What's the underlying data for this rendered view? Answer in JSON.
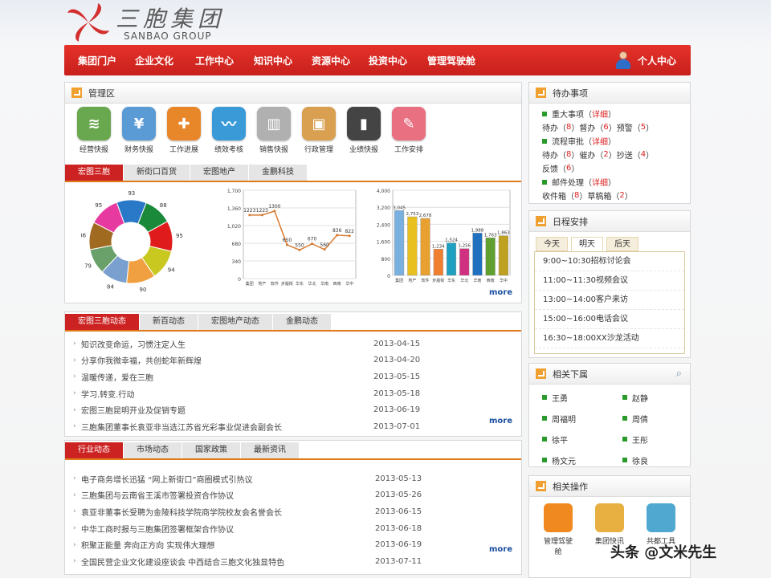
{
  "brand": {
    "cn": "三胞集团",
    "en": "SANBAO GROUP"
  },
  "nav": {
    "items": [
      "集团门户",
      "企业文化",
      "工作中心",
      "知识中心",
      "资源中心",
      "投资中心",
      "管理驾驶舱"
    ],
    "user": "个人中心"
  },
  "mgmt": {
    "title": "管理区",
    "icons": [
      {
        "label": "经营快报",
        "icon": "wifi-icon",
        "color": "#5a9a3a"
      },
      {
        "label": "财务快报",
        "icon": "yen-icon",
        "color": "#4a8ad0"
      },
      {
        "label": "工作进展",
        "icon": "gamepad-icon",
        "color": "#e07a20"
      },
      {
        "label": "绩效考核",
        "icon": "chart-icon",
        "color": "#3a9ad8"
      },
      {
        "label": "销售快报",
        "icon": "piano-icon",
        "color": "#8a8a8a"
      },
      {
        "label": "行政管理",
        "icon": "briefcase-icon",
        "color": "#d8a050"
      },
      {
        "label": "业绩快报",
        "icon": "equalizer-icon",
        "color": "#444444"
      },
      {
        "label": "工作安排",
        "icon": "pencil-icon",
        "color": "#e06070"
      }
    ],
    "tabs": [
      "宏图三胞",
      "新街口百货",
      "宏图地产",
      "金鹏科技"
    ],
    "more": "more"
  },
  "chart_data": [
    {
      "type": "pie",
      "values": [
        93,
        88,
        95,
        94,
        90,
        84,
        79,
        86,
        95
      ],
      "colors": [
        "#2a78c8",
        "#1a8a3a",
        "#e01b1b",
        "#c8c820",
        "#f0a040",
        "#7aa0d0",
        "#6aa06a",
        "#a06a20",
        "#e63aa0"
      ]
    },
    {
      "type": "line",
      "categories": [
        "集团",
        "地产",
        "软件",
        "步履街",
        "华东",
        "华北",
        "华南",
        "西南",
        "华中"
      ],
      "values": [
        1223,
        1223,
        1300,
        650,
        550,
        670,
        560,
        836,
        822
      ],
      "ylim": [
        0,
        1700
      ],
      "yticks": [
        "1,700",
        "1,360",
        "1,020",
        "680",
        "340",
        "0"
      ],
      "line_color": "#d87a30"
    },
    {
      "type": "bar",
      "categories": [
        "集团",
        "地产",
        "软件",
        "步履街",
        "华东",
        "华北",
        "华南",
        "西南",
        "华中"
      ],
      "values": [
        3045,
        2753,
        2678,
        1234,
        1524,
        1256,
        1988,
        1763,
        1863
      ],
      "ylim": [
        0,
        4000
      ],
      "yticks": [
        "4,000",
        "3,200",
        "2,400",
        "1,600",
        "800",
        "0"
      ],
      "colors": [
        "#7ab0e0",
        "#e8c020",
        "#e8a030",
        "#f08030",
        "#20a0c0",
        "#d03080",
        "#2070c0",
        "#60a030",
        "#c0a020"
      ]
    }
  ],
  "news1": {
    "tabs": [
      "宏图三胞动态",
      "新百动态",
      "宏图地产动态",
      "金鹏动态"
    ],
    "items": [
      {
        "title": "知识改变命运，习惯注定人生",
        "date": "2013-04-15"
      },
      {
        "title": "分享你我微幸福，共创蛇年新辉煌",
        "date": "2013-04-20"
      },
      {
        "title": "温暖传递，爱在三胞",
        "date": "2013-05-15"
      },
      {
        "title": "学习.转变.行动",
        "date": "2013-05-18"
      },
      {
        "title": "宏图三胞昆明开业及促销专题",
        "date": "2013-06-19"
      },
      {
        "title": "三胞集团董事长袁亚非当选江苏省光彩事业促进会副会长",
        "date": "2013-07-01"
      }
    ],
    "more": "more"
  },
  "news2": {
    "tabs": [
      "行业动态",
      "市场动态",
      "国家政策",
      "最新资讯"
    ],
    "items": [
      {
        "title": "电子商务增长迅猛 “网上新街口”商圈模式引热议",
        "date": "2013-05-13"
      },
      {
        "title": "三胞集团与云南省王溪市签署投资合作协议",
        "date": "2013-05-26"
      },
      {
        "title": "袁亚非董事长受聘为金陵科技学院商学院校友会名誉会长",
        "date": "2013-06-15"
      },
      {
        "title": "中华工商时报与三胞集团签署框架合作协议",
        "date": "2013-06-18"
      },
      {
        "title": "积聚正能量 奔向正方向 实现伟大理想",
        "date": "2013-06-19"
      },
      {
        "title": "全国民营企业文化建设座谈会 中西结合三胞文化独显特色",
        "date": "2013-07-11"
      }
    ],
    "more": "more"
  },
  "todo": {
    "title": "待办事项",
    "detail": "详细",
    "major": "重大事项",
    "major_row": [
      {
        "k": "待办",
        "v": "8"
      },
      {
        "k": "督办",
        "v": "6"
      },
      {
        "k": "预警",
        "v": "5"
      }
    ],
    "flow": "流程审批",
    "flow_row": [
      {
        "k": "待办",
        "v": "8"
      },
      {
        "k": "催办",
        "v": "2"
      },
      {
        "k": "抄送",
        "v": "4"
      }
    ],
    "flow_row2": [
      {
        "k": "反馈",
        "v": "6"
      }
    ],
    "mail": "邮件处理",
    "mail_row": [
      {
        "k": "收件箱",
        "v": "8"
      },
      {
        "k": "草稿箱",
        "v": "2"
      }
    ]
  },
  "schedule": {
    "title": "日程安排",
    "tabs": [
      "今天",
      "明天",
      "后天"
    ],
    "items": [
      "9:00~10:30招标讨论会",
      "11:00~11:30视频会议",
      "13:00~14:00客户来访",
      "15:00~16:00电话会议",
      "16:30~18:00XX沙龙活动"
    ]
  },
  "subordinates": {
    "title": "相关下属",
    "names": [
      "王勇",
      "赵静",
      "周福明",
      "周倩",
      "徐平",
      "王彤",
      "杨文元",
      "徐良"
    ]
  },
  "ops": {
    "title": "相关操作",
    "items": [
      {
        "label": "管理驾驶舱",
        "color": "#f08a20"
      },
      {
        "label": "集团快讯",
        "color": "#e8b040"
      },
      {
        "label": "共都工具",
        "color": "#50a8d0"
      }
    ]
  },
  "watermark": "头条 @文米先生"
}
